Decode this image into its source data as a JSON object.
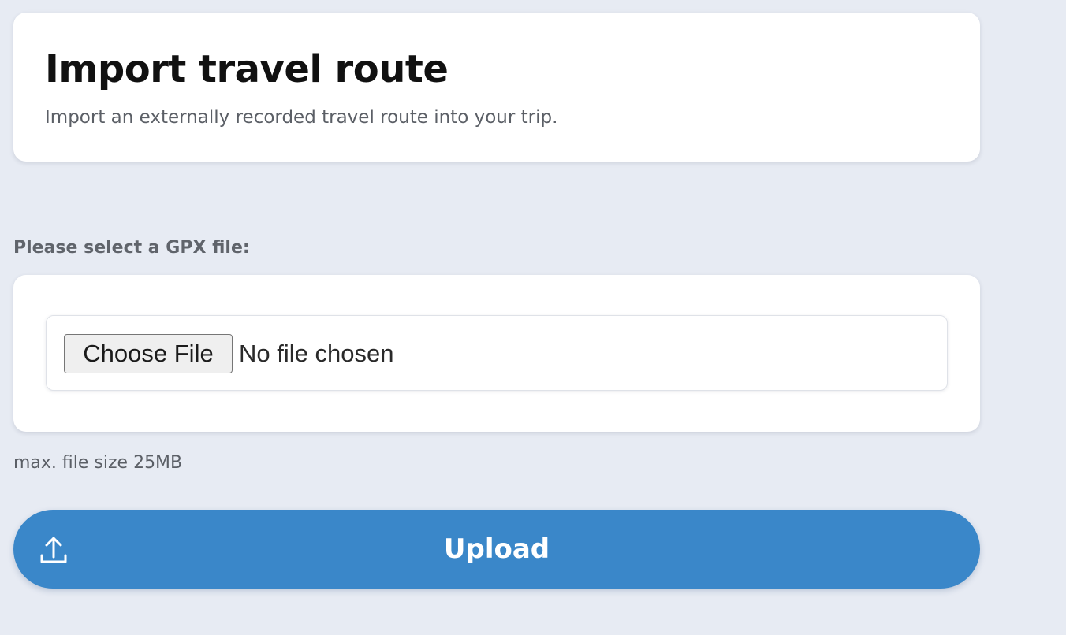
{
  "header": {
    "title": "Import travel route",
    "subtitle": "Import an externally recorded travel route into your trip."
  },
  "file_picker": {
    "label": "Please select a GPX file:",
    "choose_button": "Choose File",
    "status": "No file chosen",
    "size_note": "max. file size 25MB"
  },
  "upload": {
    "label": "Upload",
    "icon": "upload-icon"
  },
  "colors": {
    "background": "#e7ebf3",
    "card": "#ffffff",
    "accent": "#3a87c9",
    "title": "#111111",
    "muted_text": "#5b5f66"
  }
}
